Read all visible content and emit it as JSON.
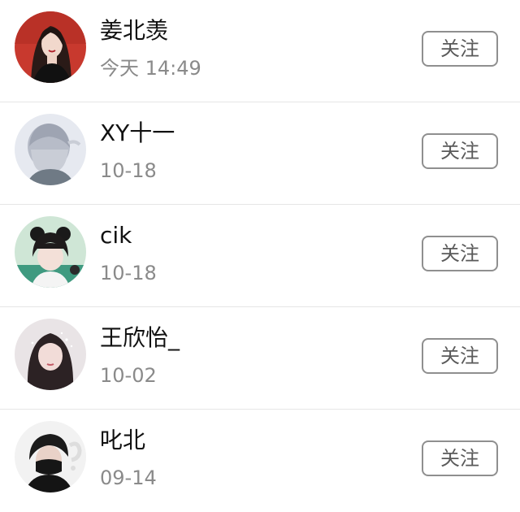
{
  "users": [
    {
      "name": "姜北羡",
      "time": "今天 14:49",
      "follow_label": "关注",
      "avatar": "avatar-red-portrait"
    },
    {
      "name": "XY十一",
      "time": "10-18",
      "follow_label": "关注",
      "avatar": "avatar-silver-hair"
    },
    {
      "name": "cik",
      "time": "10-18",
      "follow_label": "关注",
      "avatar": "avatar-girl-bangs"
    },
    {
      "name": "王欣怡_",
      "time": "10-02",
      "follow_label": "关注",
      "avatar": "avatar-girl-sparkles"
    },
    {
      "name": "叱北",
      "time": "09-14",
      "follow_label": "关注",
      "avatar": "avatar-masked-boy"
    }
  ]
}
